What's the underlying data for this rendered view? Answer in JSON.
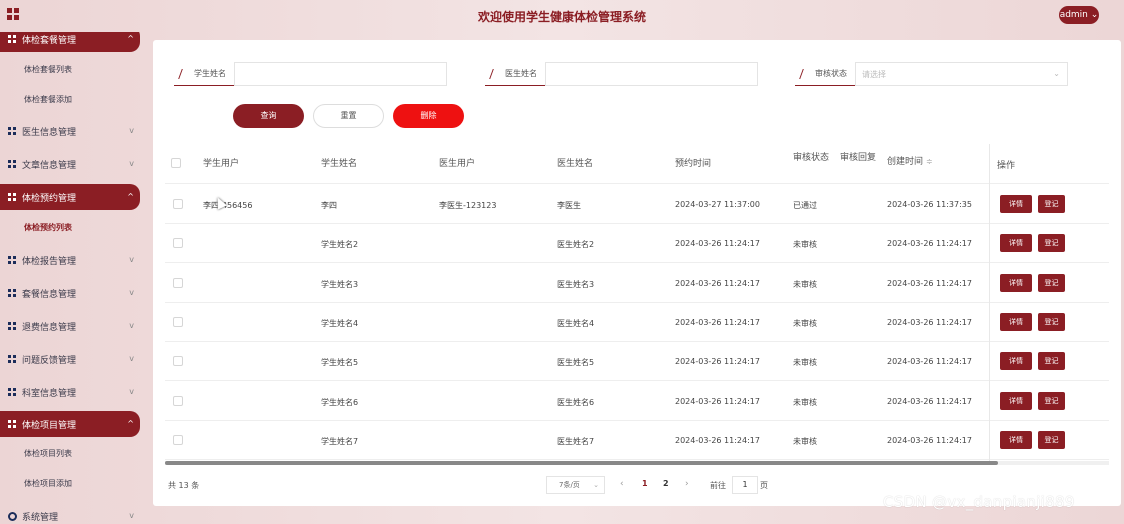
{
  "header": {
    "title": "欢迎使用学生健康体检管理系统",
    "admin_label": "admin"
  },
  "sidebar": {
    "items": [
      {
        "label": "体检套餐管理",
        "active": true,
        "chevron": "^"
      },
      {
        "label": "体检套餐列表"
      },
      {
        "label": "体检套餐添加"
      },
      {
        "label": "医生信息管理",
        "chevron": "v"
      },
      {
        "label": "文章信息管理",
        "chevron": "v"
      },
      {
        "label": "体检预约管理",
        "active": true,
        "chevron": "^"
      },
      {
        "label": "体检预约列表",
        "current": true
      },
      {
        "label": "体检报告管理",
        "chevron": "v"
      },
      {
        "label": "套餐信息管理",
        "chevron": "v"
      },
      {
        "label": "退费信息管理",
        "chevron": "v"
      },
      {
        "label": "问题反馈管理",
        "chevron": "v"
      },
      {
        "label": "科室信息管理",
        "chevron": "v"
      },
      {
        "label": "体检项目管理",
        "active": true,
        "chevron": "^"
      },
      {
        "label": "体检项目列表"
      },
      {
        "label": "体检项目添加"
      },
      {
        "label": "系统管理",
        "chevron": "v"
      }
    ]
  },
  "search": {
    "student_name_label": "学生姓名",
    "doctor_name_label": "医生姓名",
    "review_status_label": "审核状态",
    "review_status_placeholder": "请选择",
    "query_label": "查询",
    "reset_label": "重置",
    "delete_label": "删除"
  },
  "table": {
    "headers": [
      "学生用户",
      "学生姓名",
      "医生用户",
      "医生姓名",
      "预约时间",
      "审核状态",
      "审核回复",
      "创建时间",
      "操作"
    ],
    "sort_glyph": "≑",
    "detail_label": "详情",
    "register_label": "登记",
    "rows": [
      {
        "student_user": "李四-456456",
        "student_name": "李四",
        "doctor_user": "李医生-123123",
        "doctor_name": "李医生",
        "appointment_time": "2024-03-27 11:37:00",
        "status": "已通过",
        "reply": "",
        "created": "2024-03-26 11:37:35"
      },
      {
        "student_user": "",
        "student_name": "学生姓名2",
        "doctor_user": "",
        "doctor_name": "医生姓名2",
        "appointment_time": "2024-03-26 11:24:17",
        "status": "未审核",
        "reply": "",
        "created": "2024-03-26 11:24:17"
      },
      {
        "student_user": "",
        "student_name": "学生姓名3",
        "doctor_user": "",
        "doctor_name": "医生姓名3",
        "appointment_time": "2024-03-26 11:24:17",
        "status": "未审核",
        "reply": "",
        "created": "2024-03-26 11:24:17"
      },
      {
        "student_user": "",
        "student_name": "学生姓名4",
        "doctor_user": "",
        "doctor_name": "医生姓名4",
        "appointment_time": "2024-03-26 11:24:17",
        "status": "未审核",
        "reply": "",
        "created": "2024-03-26 11:24:17"
      },
      {
        "student_user": "",
        "student_name": "学生姓名5",
        "doctor_user": "",
        "doctor_name": "医生姓名5",
        "appointment_time": "2024-03-26 11:24:17",
        "status": "未审核",
        "reply": "",
        "created": "2024-03-26 11:24:17"
      },
      {
        "student_user": "",
        "student_name": "学生姓名6",
        "doctor_user": "",
        "doctor_name": "医生姓名6",
        "appointment_time": "2024-03-26 11:24:17",
        "status": "未审核",
        "reply": "",
        "created": "2024-03-26 11:24:17"
      },
      {
        "student_user": "",
        "student_name": "学生姓名7",
        "doctor_user": "",
        "doctor_name": "医生姓名7",
        "appointment_time": "2024-03-26 11:24:17",
        "status": "未审核",
        "reply": "",
        "created": "2024-03-26 11:24:17"
      }
    ]
  },
  "pagination": {
    "total_text": "共 13 条",
    "page_size": "7条/页",
    "pages": [
      "1",
      "2"
    ],
    "current_page": "1",
    "goto_label": "前往",
    "goto_value": "1",
    "page_suffix": "页"
  },
  "watermark": "CSDN @vx_danpianji889",
  "colors": {
    "primary": "#8b1e24",
    "danger": "#ee1111"
  }
}
